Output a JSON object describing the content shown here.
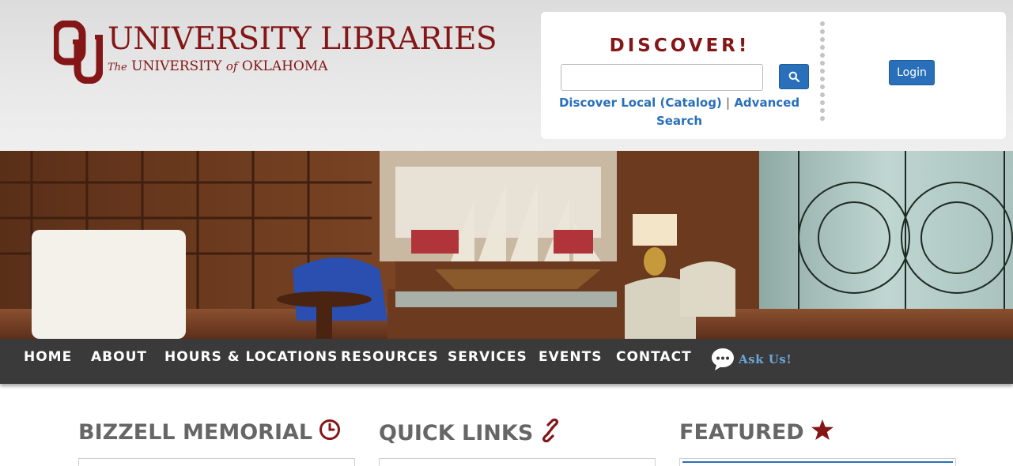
{
  "header": {
    "logo": {
      "mark_text": "OU",
      "title": "UNIVERSITY LIBRARIES",
      "subtitle_the": "The",
      "subtitle_university": "UNIVERSITY",
      "subtitle_of": "of",
      "subtitle_state": "OKLAHOMA"
    },
    "discover": {
      "title": "DISCOVER!",
      "search_value": "",
      "search_icon": "search-icon",
      "link_catalog": "Discover Local (Catalog)",
      "separator": "|",
      "link_advanced": "Advanced Search"
    },
    "login_label": "Login"
  },
  "hero": {
    "alt": "Library reading room"
  },
  "nav": {
    "items": [
      "HOME",
      "ABOUT",
      "HOURS & LOCATIONS",
      "RESOURCES",
      "SERVICES",
      "EVENTS",
      "CONTACT"
    ],
    "ask_label": "Ask Us!",
    "ask_icon": "chat-bubble-icon"
  },
  "sections": [
    {
      "title": "BIZZELL MEMORIAL",
      "icon": "clock-icon"
    },
    {
      "title": "QUICK LINKS",
      "icon": "link-icon"
    },
    {
      "title": "FEATURED",
      "icon": "star-icon"
    }
  ],
  "colors": {
    "crimson": "#841617",
    "link_blue": "#2a6fba",
    "nav_bg": "#3a3a3a",
    "heading_gray": "#666666"
  }
}
